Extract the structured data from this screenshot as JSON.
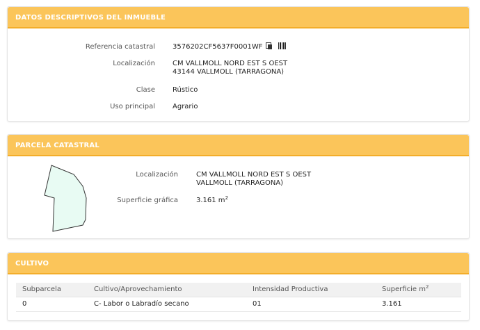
{
  "datos": {
    "title": "DATOS DESCRIPTIVOS DEL INMUEBLE",
    "referencia_label": "Referencia catastral",
    "referencia_value": "3576202CF5637F0001WF",
    "localizacion_label": "Localización",
    "localizacion_line1": "CM VALLMOLL NORD EST S OEST",
    "localizacion_line2": "43144 VALLMOLL (TARRAGONA)",
    "clase_label": "Clase",
    "clase_value": "Rústico",
    "uso_label": "Uso principal",
    "uso_value": "Agrario"
  },
  "parcela": {
    "title": "PARCELA CATASTRAL",
    "localizacion_label": "Localización",
    "localizacion_line1": "CM VALLMOLL NORD EST S OEST",
    "localizacion_line2": "VALLMOLL (TARRAGONA)",
    "superficie_label": "Superficie gráfica",
    "superficie_value": "3.161 m",
    "superficie_unit_sup": "2",
    "plot_fill": "#e8fbf3"
  },
  "cultivo": {
    "title": "CULTIVO",
    "headers": [
      "Subparcela",
      "Cultivo/Aprovechamiento",
      "Intensidad Productiva",
      "Superficie m"
    ],
    "header_sup": "2",
    "rows": [
      [
        "0",
        "C- Labor o Labradío secano",
        "01",
        "3.161"
      ]
    ]
  },
  "colors": {
    "header_bg": "#fbc55a",
    "header_border": "#f3ad2a"
  },
  "icons": [
    "copy-icon",
    "barcode-icon"
  ]
}
